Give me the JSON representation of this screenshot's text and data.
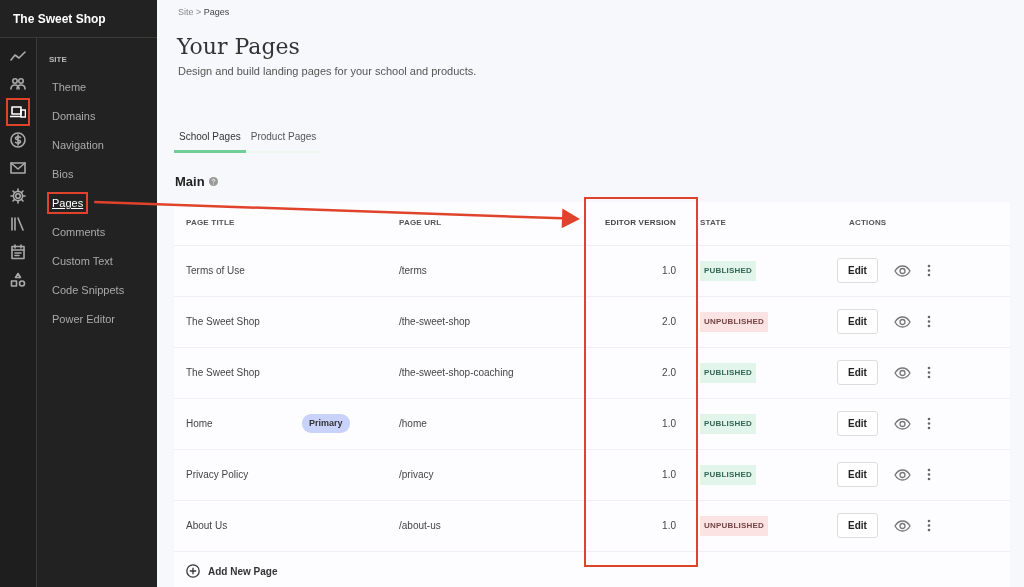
{
  "brand": "The Sweet Shop",
  "icon_rail": [
    {
      "kind": "trend",
      "selected": false,
      "highlighted": false
    },
    {
      "kind": "users",
      "selected": false,
      "highlighted": false
    },
    {
      "kind": "devices",
      "selected": true,
      "highlighted": true
    },
    {
      "kind": "dollar",
      "selected": false,
      "highlighted": false
    },
    {
      "kind": "mail",
      "selected": false,
      "highlighted": false
    },
    {
      "kind": "gear",
      "selected": false,
      "highlighted": false
    },
    {
      "kind": "library",
      "selected": false,
      "highlighted": false
    },
    {
      "kind": "calendar",
      "selected": false,
      "highlighted": false
    },
    {
      "kind": "shapes",
      "selected": false,
      "highlighted": false
    }
  ],
  "nav": {
    "section": "SITE",
    "items": [
      {
        "label": "Theme",
        "selected": false,
        "highlighted": false
      },
      {
        "label": "Domains",
        "selected": false,
        "highlighted": false
      },
      {
        "label": "Navigation",
        "selected": false,
        "highlighted": false
      },
      {
        "label": "Bios",
        "selected": false,
        "highlighted": false
      },
      {
        "label": "Pages",
        "selected": true,
        "highlighted": true
      },
      {
        "label": "Comments",
        "selected": false,
        "highlighted": false
      },
      {
        "label": "Custom Text",
        "selected": false,
        "highlighted": false
      },
      {
        "label": "Code Snippets",
        "selected": false,
        "highlighted": false
      },
      {
        "label": "Power Editor",
        "selected": false,
        "highlighted": false
      }
    ]
  },
  "breadcrumb": {
    "items": [
      "Site",
      "Pages"
    ],
    "separator": ">"
  },
  "title": "Your Pages",
  "subtitle": "Design and build landing pages for your school and products.",
  "tabs": [
    {
      "label": "School Pages",
      "selected": true
    },
    {
      "label": "Product Pages",
      "selected": false
    }
  ],
  "section": {
    "title": "Main"
  },
  "table": {
    "columns": [
      {
        "label": "PAGE TITLE",
        "highlighted": false
      },
      {
        "label": "PAGE URL",
        "highlighted": false
      },
      {
        "label": "EDITOR VERSION",
        "highlighted": true
      },
      {
        "label": "STATE",
        "highlighted": false
      },
      {
        "label": "ACTIONS",
        "highlighted": false
      }
    ],
    "rows": [
      {
        "title": "Terms of Use",
        "url": "/terms",
        "version": "1.0",
        "state": {
          "label": "PUBLISHED",
          "kind": "published"
        },
        "action": "Edit"
      },
      {
        "title": "The Sweet Shop",
        "url": "/the-sweet-shop",
        "version": "2.0",
        "state": {
          "label": "UNPUBLISHED",
          "kind": "unpublished"
        },
        "action": "Edit"
      },
      {
        "title": "The Sweet Shop",
        "url": "/the-sweet-shop-coaching",
        "version": "2.0",
        "state": {
          "label": "PUBLISHED",
          "kind": "published"
        },
        "action": "Edit"
      },
      {
        "title": "Home",
        "badge": "Primary",
        "url": "/home",
        "version": "1.0",
        "state": {
          "label": "PUBLISHED",
          "kind": "published"
        },
        "action": "Edit"
      },
      {
        "title": "Privacy Policy",
        "url": "/privacy",
        "version": "1.0",
        "state": {
          "label": "PUBLISHED",
          "kind": "published"
        },
        "action": "Edit"
      },
      {
        "title": "About Us",
        "url": "/about-us",
        "version": "1.0",
        "state": {
          "label": "UNPUBLISHED",
          "kind": "unpublished"
        },
        "action": "Edit"
      }
    ]
  },
  "add_button": "Add New Page"
}
